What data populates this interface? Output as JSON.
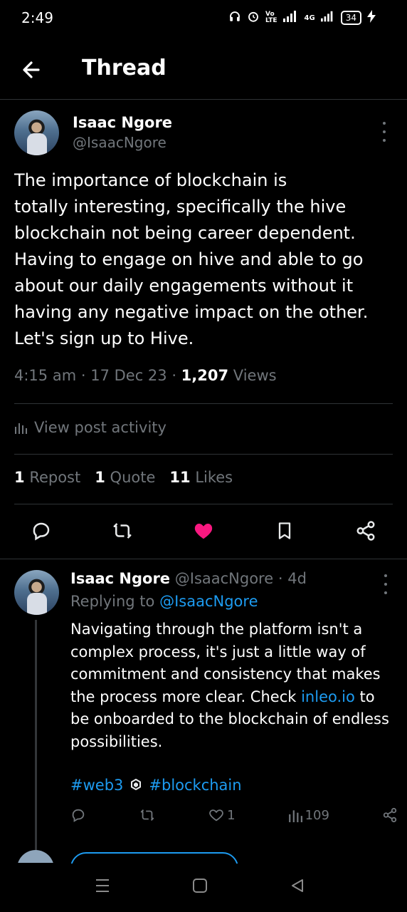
{
  "status_bar": {
    "time": "2:49",
    "network_label": "4G",
    "battery": "34"
  },
  "header": {
    "title": "Thread"
  },
  "main_tweet": {
    "author_name": "Isaac Ngore",
    "author_handle": "@IsaacNgore",
    "text": "The importance of blockchain is\ntotally interesting, specifically the hive\nblockchain not being career dependent.\nHaving to engage on hive and able to go\nabout our daily engagements without it\nhaving any negative impact on the other.\nLet's sign up to Hive.",
    "time": "4:15 am",
    "date": "17 Dec 23",
    "views_count": "1,207",
    "views_label": "Views",
    "activity_label": "View post activity",
    "reposts_count": "1",
    "reposts_label": "Repost",
    "quotes_count": "1",
    "quotes_label": "Quote",
    "likes_count": "11",
    "likes_label": "Likes"
  },
  "reply": {
    "author_name": "Isaac Ngore",
    "author_handle": "@IsaacNgore",
    "age": "4d",
    "replying_prefix": "Replying to",
    "replying_handle": "@IsaacNgore",
    "text_before_link": "Navigating through the platform isn't a complex process, it's just a little way of commitment and consistency that makes the process more clear. Check ",
    "link": "inleo.io",
    "text_after_link": " to be onboarded to the blockchain of endless possibilities.",
    "hashtag_1": "#web3",
    "hashtag_2": "#blockchain",
    "likes": "1",
    "views": "109"
  },
  "colors": {
    "background": "#000000",
    "text": "#e7e9ea",
    "secondary": "#71767b",
    "link": "#1d9bf0",
    "like": "#f91880",
    "divider": "#2f3336"
  }
}
